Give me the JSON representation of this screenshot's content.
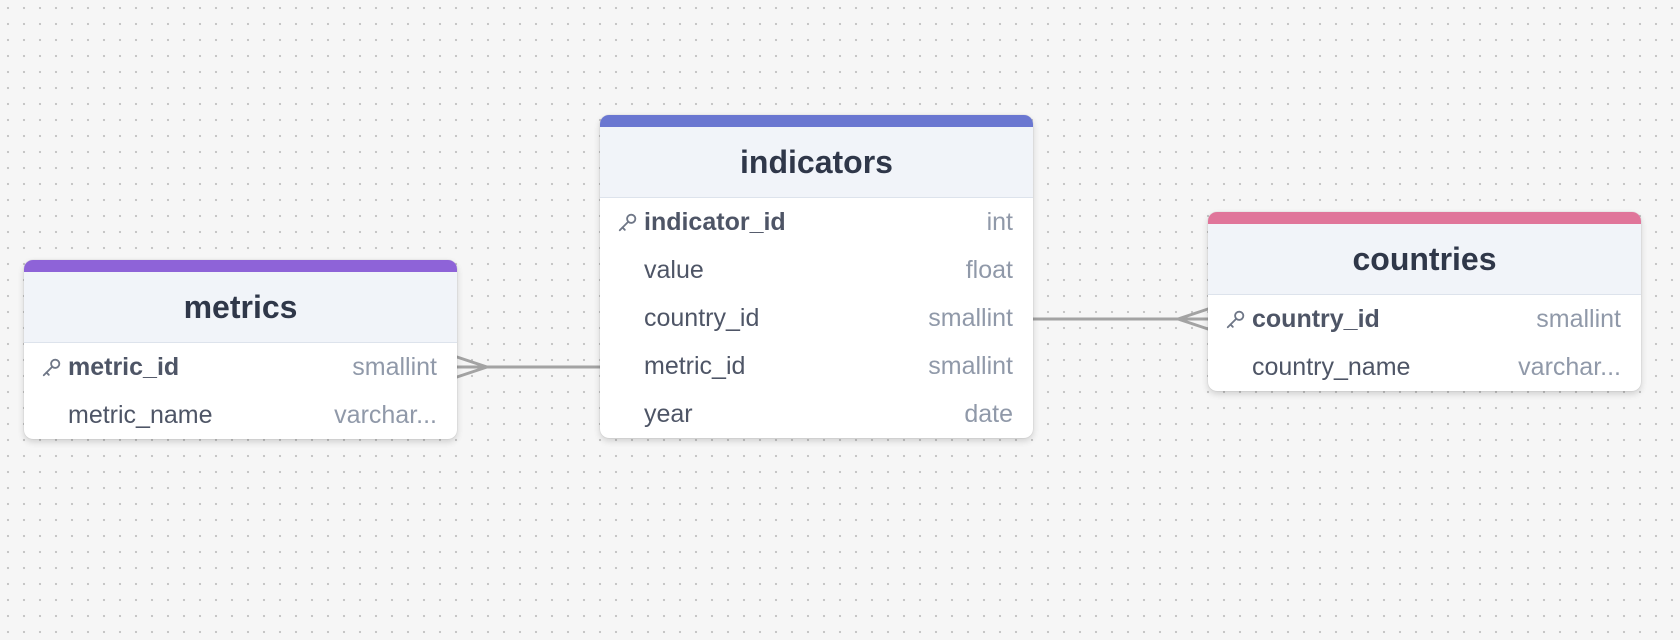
{
  "tables": {
    "metrics": {
      "name": "metrics",
      "accent": "#8e63d8",
      "columns": [
        {
          "name": "metric_id",
          "type": "smallint",
          "pk": true
        },
        {
          "name": "metric_name",
          "type": "varchar...",
          "pk": false
        }
      ]
    },
    "indicators": {
      "name": "indicators",
      "accent": "#6a77d1",
      "columns": [
        {
          "name": "indicator_id",
          "type": "int",
          "pk": true
        },
        {
          "name": "value",
          "type": "float",
          "pk": false
        },
        {
          "name": "country_id",
          "type": "smallint",
          "pk": false
        },
        {
          "name": "metric_id",
          "type": "smallint",
          "pk": false
        },
        {
          "name": "year",
          "type": "date",
          "pk": false
        }
      ]
    },
    "countries": {
      "name": "countries",
      "accent": "#e0759a",
      "columns": [
        {
          "name": "country_id",
          "type": "smallint",
          "pk": true
        },
        {
          "name": "country_name",
          "type": "varchar...",
          "pk": false
        }
      ]
    }
  },
  "relationships": [
    {
      "from": "indicators.metric_id",
      "to": "metrics.metric_id",
      "cardinality": "many-to-one"
    },
    {
      "from": "indicators.country_id",
      "to": "countries.country_id",
      "cardinality": "many-to-one"
    }
  ],
  "colors": {
    "connector": "#a3a3a3",
    "key_icon": "#6f7787"
  },
  "icons": {
    "primary_key": "key-icon"
  }
}
